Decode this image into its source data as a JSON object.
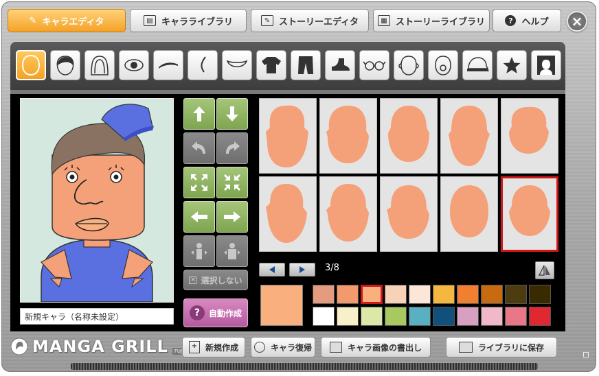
{
  "tabs": [
    {
      "label": "キャラエディタ",
      "icon": "pencil-icon",
      "active": true
    },
    {
      "label": "キャラライブラリ",
      "icon": "book-icon",
      "active": false
    },
    {
      "label": "ストーリーエディタ",
      "icon": "document-edit-icon",
      "active": false
    },
    {
      "label": "ストーリーライブラリ",
      "icon": "film-library-icon",
      "active": false
    },
    {
      "label": "ヘルプ",
      "icon": "question-icon",
      "active": false
    }
  ],
  "close_label": "×",
  "parts": [
    "face-outline",
    "hair",
    "hair-back",
    "eye",
    "eyebrow",
    "nose",
    "mouth",
    "shirt",
    "pants",
    "shoe",
    "glasses",
    "ear",
    "face-detail",
    "hat",
    "star",
    "background"
  ],
  "controls": {
    "disabled_select_label": "選択しない",
    "auto_create_label": "自動作成"
  },
  "pager": {
    "current": "3/8"
  },
  "character_name": "新規キャラ（名称未設定）",
  "colors": {
    "skin": "#f4a078",
    "current": "#f9b07e",
    "accent_orange": "#f4a227",
    "selected_border": "#d01818",
    "palette": [
      "#e49c80",
      "#f29a6e",
      "#f9b07e",
      "#f8d2b8",
      "#fce6d8",
      "#f4b83e",
      "#f08030",
      "#c86a10",
      "#4c3c10",
      "#3a2a00",
      "#ffffff",
      "#f8f0c8",
      "#dce8a8",
      "#a8c860",
      "#58b0c0",
      "#10507a",
      "#d8a0c0",
      "#f0b8c8",
      "#e87888",
      "#e02830"
    ],
    "selected_index": 2
  },
  "thumbnails_selected_index": 9,
  "bottom_buttons": [
    {
      "label": "新規作成",
      "icon": "new-doc-icon"
    },
    {
      "label": "キャラ復帰",
      "icon": "restore-icon"
    },
    {
      "label": "キャラ画像の書出し",
      "icon": "export-image-icon"
    },
    {
      "label": "ライブラリに保存",
      "icon": "save-library-icon"
    }
  ],
  "logo": {
    "main": "MANGA GRILL",
    "sub": "FUJI TELEVISION"
  }
}
